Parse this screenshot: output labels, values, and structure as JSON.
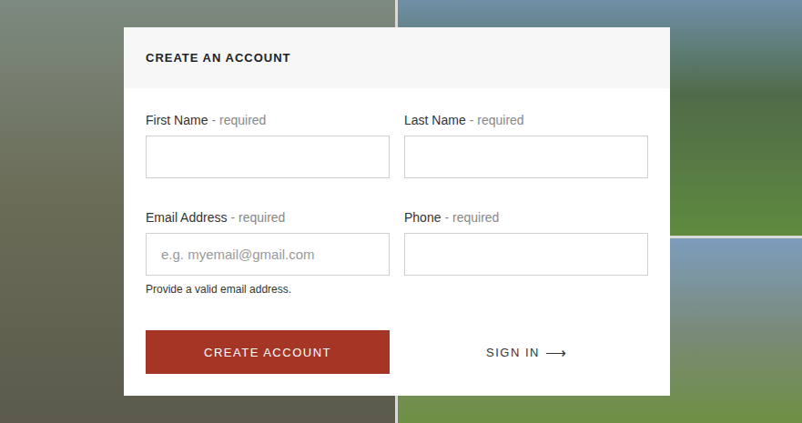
{
  "form": {
    "title": "CREATE AN ACCOUNT",
    "fields": [
      {
        "label": "First Name",
        "note": "- required",
        "placeholder": "",
        "help": ""
      },
      {
        "label": "Last Name",
        "note": "- required",
        "placeholder": "",
        "help": ""
      },
      {
        "label": "Email Address",
        "note": "- required",
        "placeholder": "e.g. myemail@gmail.com",
        "help": "Provide a valid email address."
      },
      {
        "label": "Phone",
        "note": "- required",
        "placeholder": "",
        "help": ""
      }
    ],
    "submit": "CREATE ACCOUNT",
    "signin": {
      "label": "SIGN IN",
      "arrow": "⟶"
    }
  }
}
